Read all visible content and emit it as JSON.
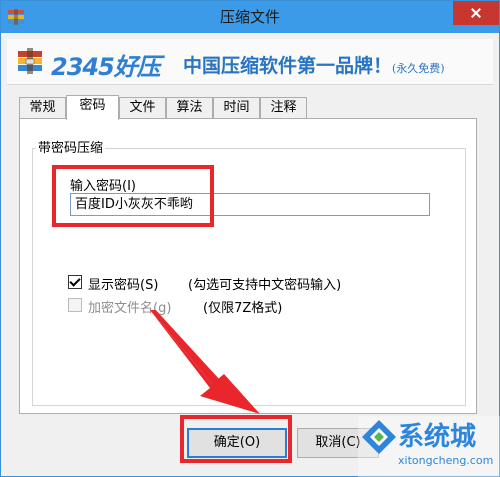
{
  "window": {
    "title": "压缩文件"
  },
  "banner": {
    "brand": "2345好压",
    "slogan": "中国压缩软件第一品牌！",
    "slogan_note": "(永久免费)"
  },
  "tabs": [
    {
      "label": "常规"
    },
    {
      "label": "密码",
      "active": true
    },
    {
      "label": "文件"
    },
    {
      "label": "算法"
    },
    {
      "label": "时间"
    },
    {
      "label": "注释"
    }
  ],
  "password_group": {
    "legend": "带密码压缩",
    "input_label": "输入密码(I)",
    "input_value": "百度ID小灰灰不乖哟",
    "show_password": {
      "label": "显示密码(S)",
      "hint": "(勾选可支持中文密码输入)",
      "checked": true
    },
    "encrypt_filenames": {
      "label": "加密文件名(g)",
      "hint": "(仅限7Z格式)",
      "checked": false,
      "disabled": true
    }
  },
  "buttons": {
    "ok": "确定(O)",
    "cancel": "取消(C)"
  },
  "watermark": {
    "text": "系统城",
    "url": "xitongcheng.com"
  },
  "colors": {
    "titlebar": "#3b9be8",
    "highlight": "#e8262b",
    "brand": "#2f7fd3"
  }
}
